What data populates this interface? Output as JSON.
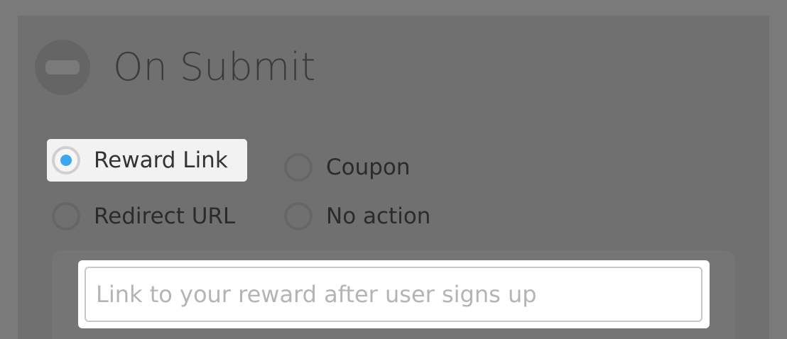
{
  "section": {
    "title": "On Submit",
    "collapse_icon": "minus-circle-icon"
  },
  "options": [
    {
      "label": "Reward Link",
      "selected": true
    },
    {
      "label": "Coupon",
      "selected": false
    },
    {
      "label": "Redirect URL",
      "selected": false
    },
    {
      "label": "No action",
      "selected": false
    }
  ],
  "reward_link": {
    "value": "",
    "placeholder": "Link to your reward after user signs up"
  },
  "colors": {
    "accent": "#3ca6f0",
    "overlay": "#7a7a7a",
    "highlight": "#f2f2f2"
  }
}
